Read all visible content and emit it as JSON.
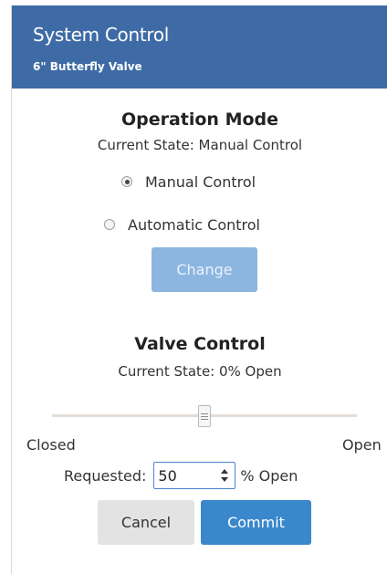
{
  "header": {
    "title": "System Control",
    "subtitle": "6\" Butterfly Valve"
  },
  "operation_mode": {
    "title": "Operation Mode",
    "current_state": "Current State: Manual Control",
    "options": [
      {
        "label": "Manual Control",
        "selected": true
      },
      {
        "label": "Automatic Control",
        "selected": false
      }
    ],
    "change_label": "Change"
  },
  "valve_control": {
    "title": "Valve Control",
    "current_state": "Current State: 0% Open",
    "slider": {
      "min_label": "Closed",
      "max_label": "Open",
      "value_percent": 50
    },
    "requested": {
      "label": "Requested:",
      "value": "50",
      "unit": "% Open"
    },
    "cancel_label": "Cancel",
    "commit_label": "Commit"
  },
  "colors": {
    "header_bg": "#3e6ba5",
    "primary_button": "#3a88cc",
    "disabled_button": "#8cb6e0"
  },
  "icons": {
    "radio": "radio-button",
    "slider_handle": "grip-lines",
    "spinner": "up-down-arrows"
  }
}
